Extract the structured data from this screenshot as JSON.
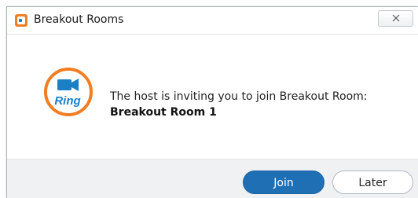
{
  "window": {
    "title": "Breakout Rooms",
    "app_icon": "ringcentral-app-icon",
    "close_icon": "close-icon"
  },
  "dialog": {
    "logo_text": "Ring",
    "message": "The host is inviting you to join Breakout Room:",
    "room_name": "Breakout Room 1"
  },
  "buttons": {
    "join_label": "Join",
    "later_label": "Later"
  },
  "colors": {
    "accent_orange": "#f07e23",
    "brand_blue": "#1a7fc4",
    "join_button": "#1f6fb4",
    "footer_bg": "#f0f1f3"
  }
}
